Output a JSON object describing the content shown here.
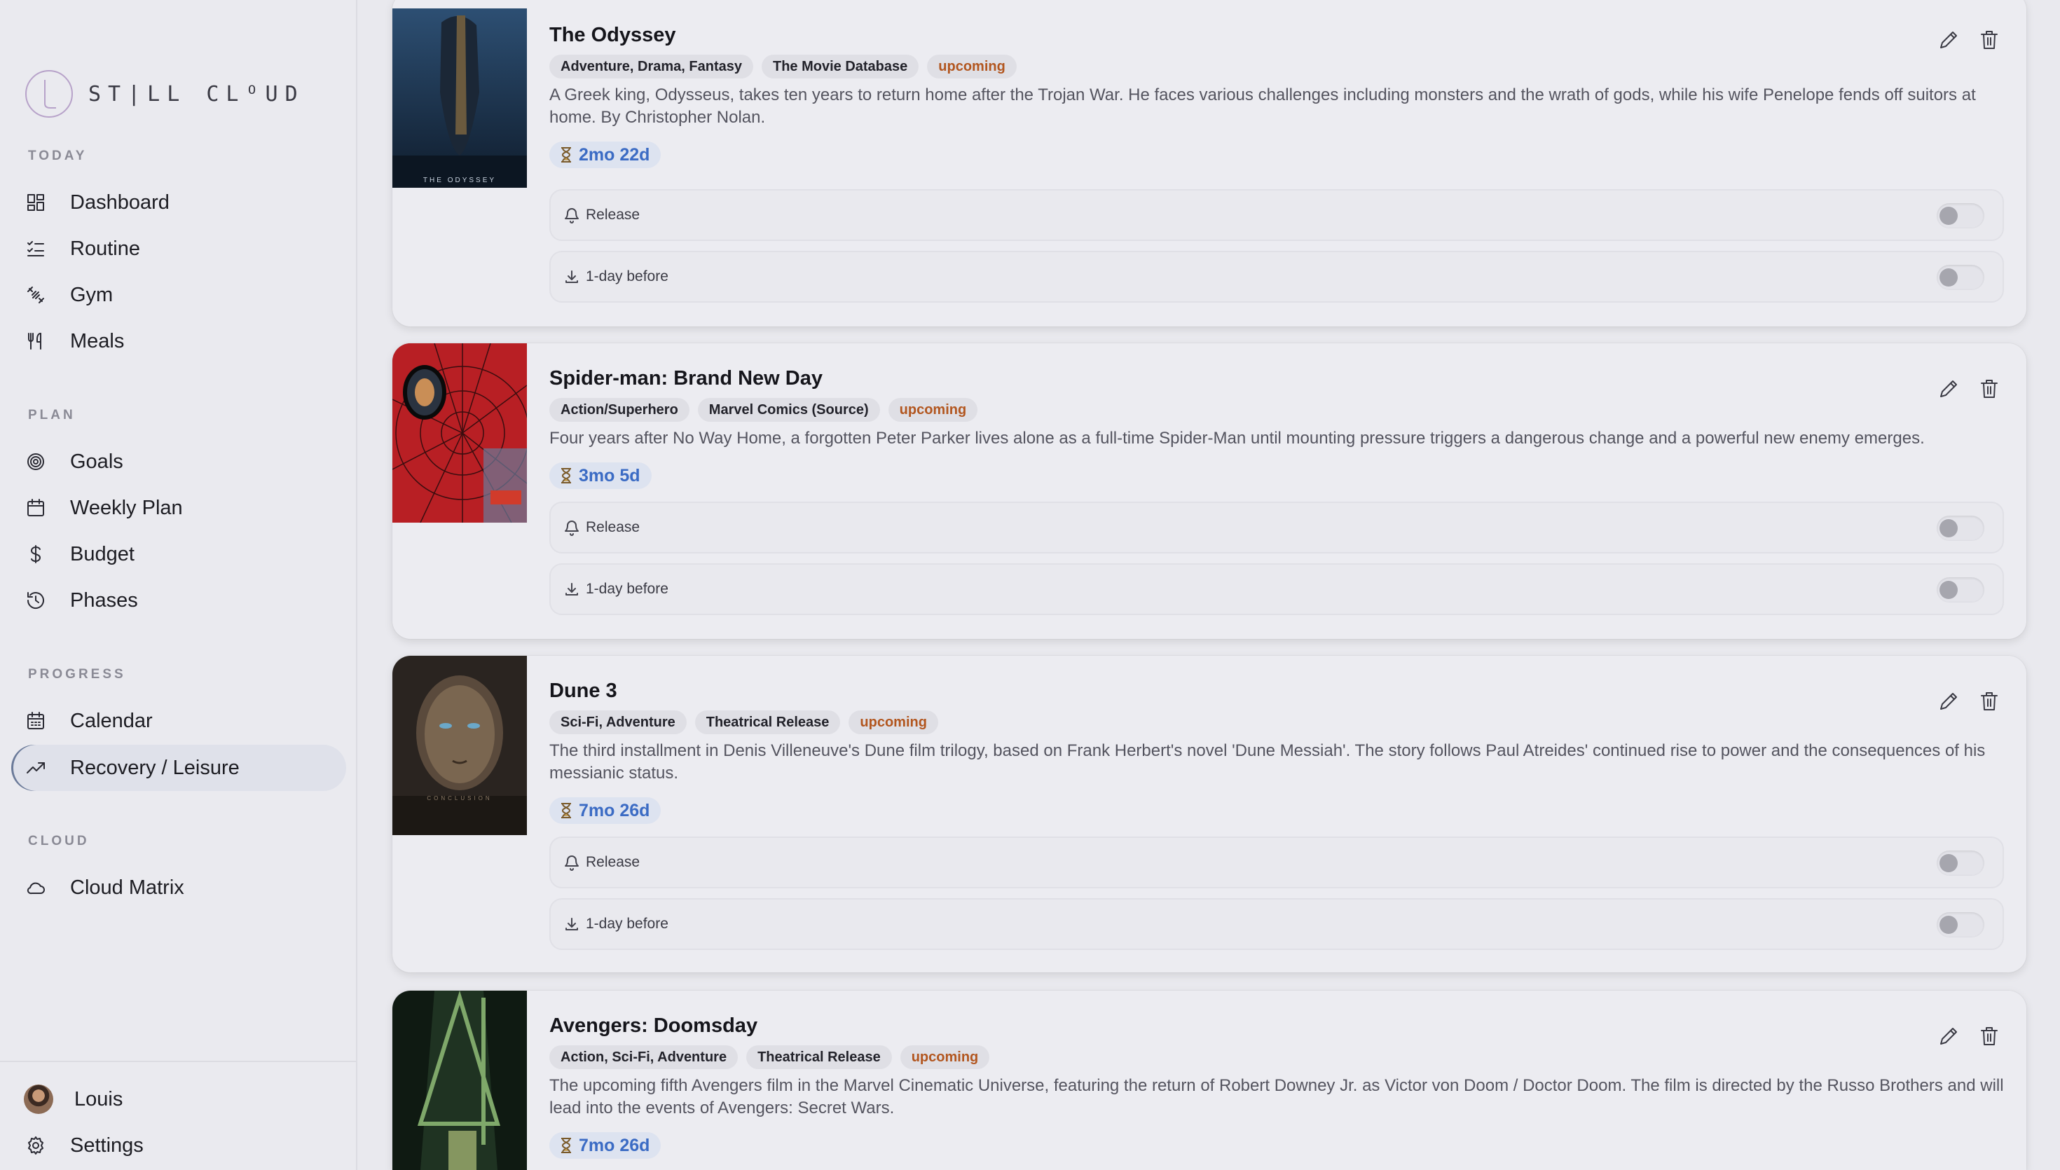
{
  "app": {
    "logo_text": "ST|LL CLᴼUD"
  },
  "sidebar": {
    "sections": [
      {
        "label": "TODAY",
        "items": [
          {
            "label": "Dashboard",
            "icon": "dashboard-icon"
          },
          {
            "label": "Routine",
            "icon": "list-checks-icon"
          },
          {
            "label": "Gym",
            "icon": "dumbbell-icon"
          },
          {
            "label": "Meals",
            "icon": "utensils-icon"
          }
        ]
      },
      {
        "label": "PLAN",
        "items": [
          {
            "label": "Goals",
            "icon": "target-icon"
          },
          {
            "label": "Weekly Plan",
            "icon": "calendar-icon"
          },
          {
            "label": "Budget",
            "icon": "dollar-icon"
          },
          {
            "label": "Phases",
            "icon": "history-icon"
          }
        ]
      },
      {
        "label": "PROGRESS",
        "items": [
          {
            "label": "Calendar",
            "icon": "calendar-days-icon"
          },
          {
            "label": "Recovery / Leisure",
            "icon": "trending-up-icon",
            "active": true
          }
        ]
      },
      {
        "label": "CLOUD",
        "items": [
          {
            "label": "Cloud Matrix",
            "icon": "cloud-icon"
          }
        ]
      }
    ],
    "footer": {
      "user_name": "Louis",
      "settings_label": "Settings"
    }
  },
  "cards": [
    {
      "title": "The Odyssey",
      "tags": [
        "Adventure, Drama, Fantasy",
        "The Movie Database"
      ],
      "status": "upcoming",
      "description": "A Greek king, Odysseus, takes ten years to return home after the Trojan War. He faces various challenges including monsters and the wrath of gods, while his wife Penelope fends off suitors at home. By Christopher Nolan.",
      "countdown": "2mo 22d",
      "poster_text": "THE ODYSSEY",
      "notifications": [
        {
          "label": "Release",
          "icon": "bell-icon",
          "enabled": false
        },
        {
          "label": "1-day before",
          "icon": "download-icon",
          "enabled": false
        }
      ]
    },
    {
      "title": "Spider-man: Brand New Day",
      "tags": [
        "Action/Superhero",
        "Marvel Comics (Source)"
      ],
      "status": "upcoming",
      "description": "Four years after No Way Home, a forgotten Peter Parker lives alone as a full-time Spider-Man until mounting pressure triggers a dangerous change and a powerful new enemy emerges.",
      "countdown": "3mo 5d",
      "notifications": [
        {
          "label": "Release",
          "icon": "bell-icon",
          "enabled": false
        },
        {
          "label": "1-day before",
          "icon": "download-icon",
          "enabled": false
        }
      ]
    },
    {
      "title": "Dune 3",
      "tags": [
        "Sci-Fi, Adventure",
        "Theatrical Release"
      ],
      "status": "upcoming",
      "description": "The third installment in Denis Villeneuve's Dune film trilogy, based on Frank Herbert's novel 'Dune Messiah'. The story follows Paul Atreides' continued rise to power and the consequences of his messianic status.",
      "countdown": "7mo 26d",
      "poster_text": "CONCLUSION",
      "notifications": [
        {
          "label": "Release",
          "icon": "bell-icon",
          "enabled": false
        },
        {
          "label": "1-day before",
          "icon": "download-icon",
          "enabled": false
        }
      ]
    },
    {
      "title": "Avengers: Doomsday",
      "tags": [
        "Action, Sci-Fi, Adventure",
        "Theatrical Release"
      ],
      "status": "upcoming",
      "description": "The upcoming fifth Avengers film in the Marvel Cinematic Universe, featuring the return of Robert Downey Jr. as Victor von Doom / Doctor Doom. The film is directed by the Russo Brothers and will lead into the events of Avengers: Secret Wars.",
      "countdown": "7mo 26d",
      "notifications": []
    }
  ]
}
